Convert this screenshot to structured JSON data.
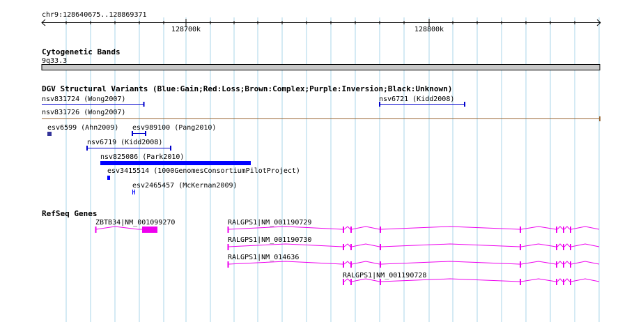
{
  "ruler": {
    "range": "chr9:128640675..128869371",
    "ticks": [
      "128700k",
      "128800k"
    ]
  },
  "cytoband": {
    "title": "Cytogenetic Bands",
    "band": "9q33.3"
  },
  "dgv": {
    "title": "DGV Structural Variants (Blue:Gain;Red:Loss;Brown:Complex;Purple:Inversion;Black:Unknown)",
    "features": [
      {
        "name": "nsv831724 (Wong2007)",
        "color": "#0000cc"
      },
      {
        "name": "nsv6721 (Kidd2008)",
        "color": "#0000cc"
      },
      {
        "name": "nsv831726 (Wong2007)",
        "color": "#996633"
      },
      {
        "name": "esv6599 (Ahn2009)",
        "color": "#333399"
      },
      {
        "name": "esv989100 (Pang2010)",
        "color": "#0000cc"
      },
      {
        "name": "nsv6719 (Kidd2008)",
        "color": "#0000cc"
      },
      {
        "name": "nsv825086 (Park2010)",
        "color": "#0000ff"
      },
      {
        "name": "esv3415514 (1000GenomesConsortiumPilotProject)",
        "color": "#0000ff"
      },
      {
        "name": "esv2465457 (McKernan2009)",
        "color": "#0000ff"
      }
    ]
  },
  "refseq": {
    "title": "RefSeq Genes",
    "color": "#ee00ee",
    "genes": [
      {
        "name": "ZBTB34|NM_001099270"
      },
      {
        "name": "RALGPS1|NM_001190729"
      },
      {
        "name": "RALGPS1|NM_001190730"
      },
      {
        "name": "RALGPS1|NM_014636"
      },
      {
        "name": "RALGPS1|NM_001190728"
      }
    ]
  },
  "colors": {
    "gridline": "#a8d4e8",
    "cytoband": "#c8c8c8"
  }
}
